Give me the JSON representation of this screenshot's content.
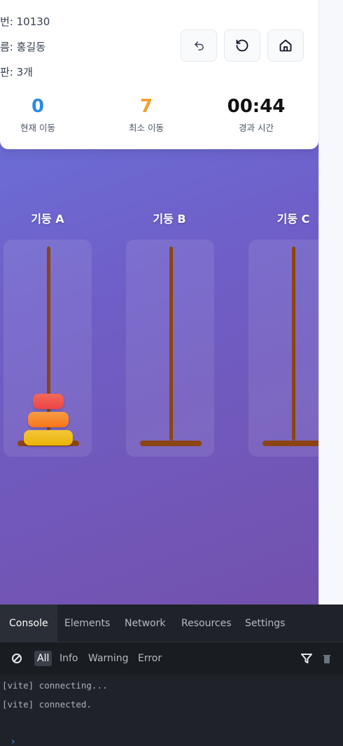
{
  "info": {
    "line1": "번: 10130",
    "line2": "름: 홍길동",
    "line3": "판: 3개"
  },
  "controls": {
    "undo_icon": "undo-icon",
    "reset_icon": "refresh-icon",
    "home_icon": "home-icon"
  },
  "stats": [
    {
      "value": "0",
      "label": "현재 이동",
      "color": "#2b8ae6"
    },
    {
      "value": "7",
      "label": "최소 이동",
      "color": "#f59e2a"
    },
    {
      "value": "00:44",
      "label": "경과 시간",
      "color": "#111111"
    }
  ],
  "pegs": [
    {
      "title": "기둥 A"
    },
    {
      "title": "기둥 B"
    },
    {
      "title": "기둥 C"
    }
  ],
  "disks": [
    {
      "peg": 0,
      "size": 1,
      "color_start": "#ef4444",
      "color_end": "#f06a5a"
    },
    {
      "peg": 0,
      "size": 2,
      "color_start": "#f97316",
      "color_end": "#f59e46"
    },
    {
      "peg": 0,
      "size": 3,
      "color_start": "#eab308",
      "color_end": "#f5c53a"
    }
  ],
  "console": {
    "tabs": [
      "Console",
      "Elements",
      "Network",
      "Resources",
      "Settings"
    ],
    "filters": [
      "All",
      "Info",
      "Warning",
      "Error"
    ],
    "logs": [
      "[vite] connecting...",
      "[vite] connected."
    ],
    "prompt": "›"
  }
}
